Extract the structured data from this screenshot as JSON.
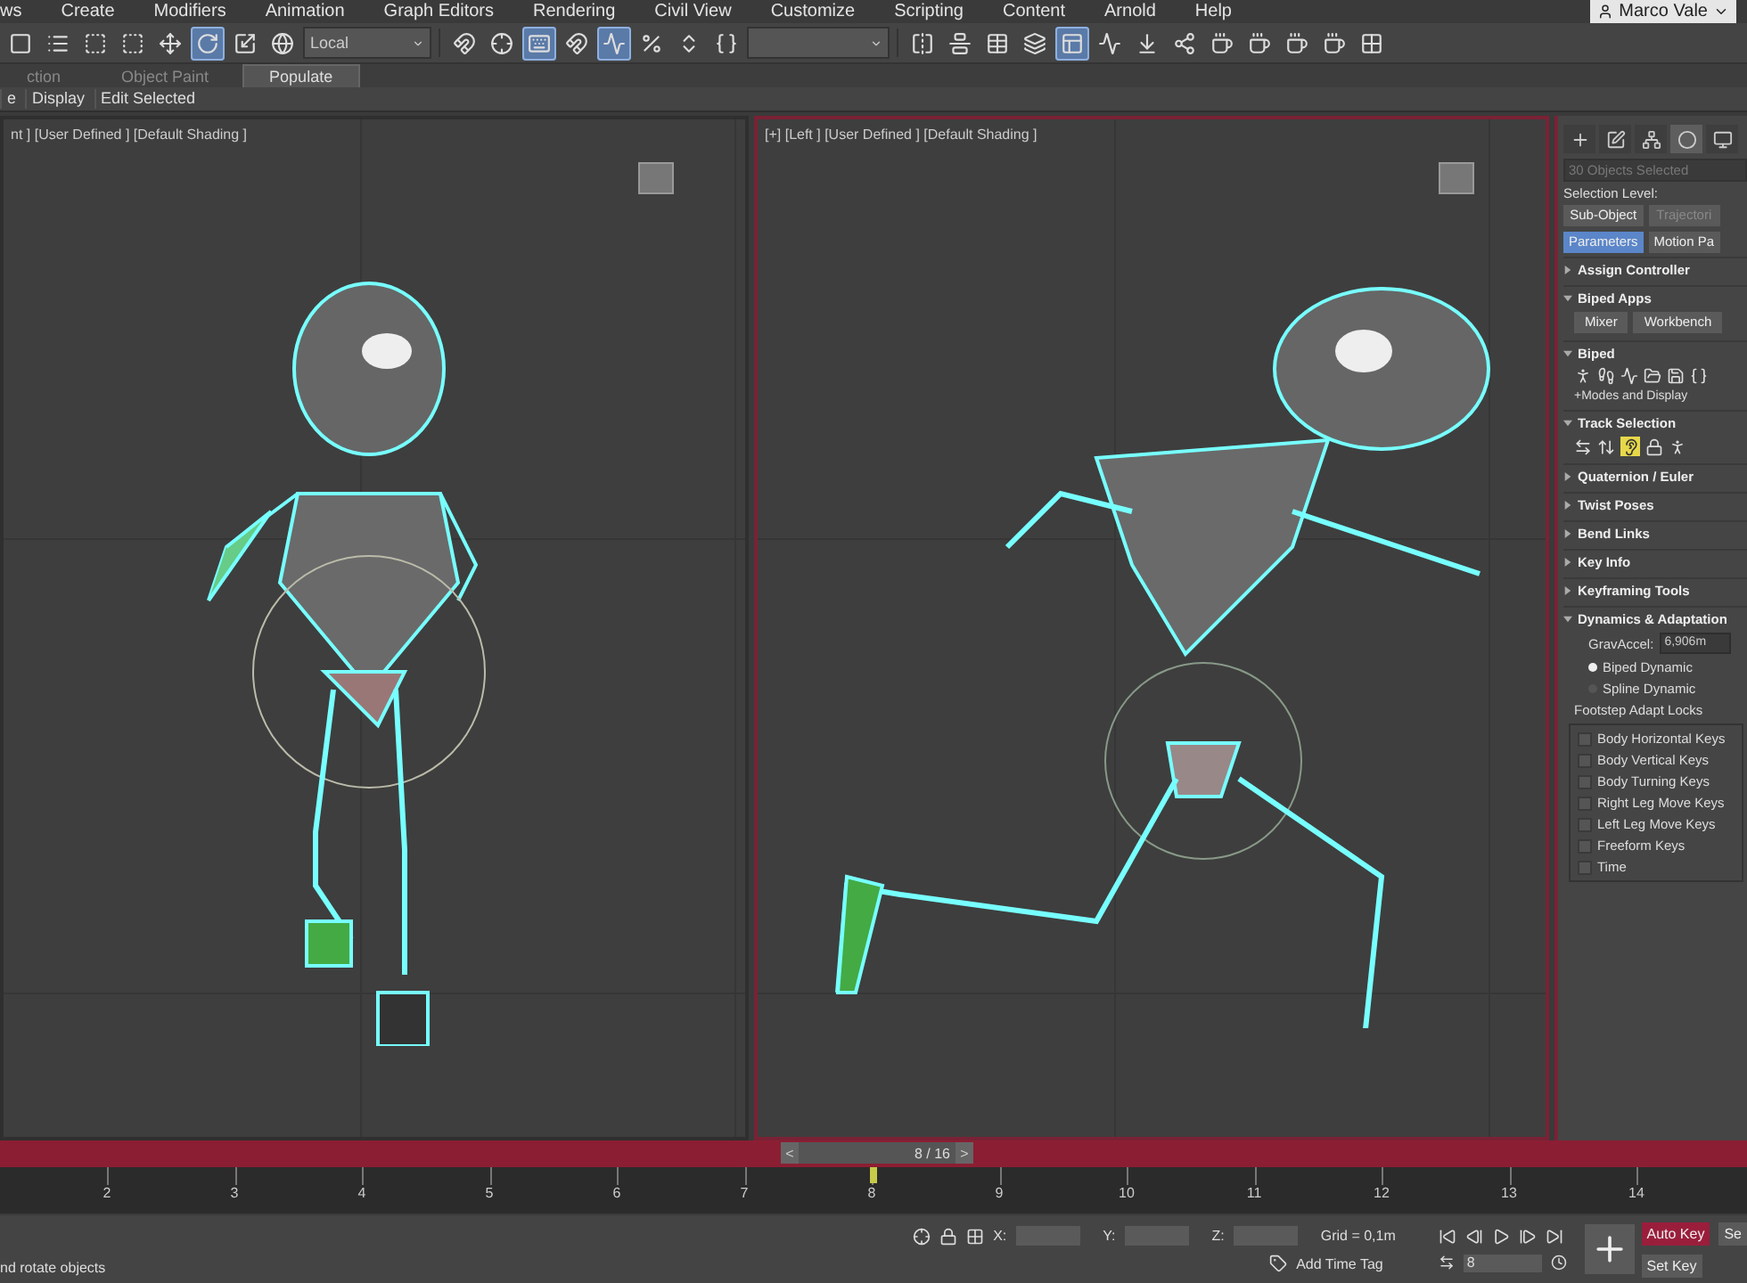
{
  "menu": [
    "ws",
    "Create",
    "Modifiers",
    "Animation",
    "Graph Editors",
    "Rendering",
    "Civil View",
    "Customize",
    "Scripting",
    "Content",
    "Arnold",
    "Help"
  ],
  "user": "Marco Vale",
  "toolbar": {
    "tools": [
      {
        "kind": "select",
        "selected": false
      },
      {
        "kind": "list",
        "selected": false
      },
      {
        "kind": "region",
        "selected": false
      },
      {
        "kind": "window",
        "selected": false
      },
      {
        "kind": "move",
        "selected": false
      },
      {
        "kind": "rotate",
        "selected": true
      },
      {
        "kind": "scale",
        "selected": false
      },
      {
        "kind": "place",
        "selected": false
      }
    ],
    "coordinate_system": "Local",
    "snaps": [
      {
        "kind": "pivot",
        "selected": false
      },
      {
        "kind": "snap",
        "selected": false
      },
      {
        "kind": "keyboard",
        "selected": true
      },
      {
        "kind": "snap3",
        "selected": false
      },
      {
        "kind": "angle",
        "selected": true
      },
      {
        "kind": "percent",
        "selected": false
      },
      {
        "kind": "spinner",
        "selected": false
      },
      {
        "kind": "braces",
        "selected": false
      }
    ],
    "right_tools": [
      {
        "kind": "mirror",
        "selected": false
      },
      {
        "kind": "align",
        "selected": false
      },
      {
        "kind": "layers",
        "selected": false
      },
      {
        "kind": "stack",
        "selected": false
      },
      {
        "kind": "ribbon",
        "selected": true
      },
      {
        "kind": "curves",
        "selected": false
      },
      {
        "kind": "dope",
        "selected": false
      },
      {
        "kind": "schematic",
        "selected": false
      },
      {
        "kind": "teapot",
        "selected": false
      },
      {
        "kind": "teapot",
        "selected": false
      },
      {
        "kind": "teapot",
        "selected": false
      },
      {
        "kind": "teapot",
        "selected": false
      },
      {
        "kind": "grid",
        "selected": false
      }
    ]
  },
  "ribbon_tabs": [
    {
      "label": "ction",
      "selected": false
    },
    {
      "label": "Object Paint",
      "selected": false
    },
    {
      "label": "Populate",
      "selected": true
    }
  ],
  "sub_tabs": [
    {
      "label": "e",
      "selected": false
    },
    {
      "label": "Display",
      "selected": false
    },
    {
      "label": "Edit Selected",
      "selected": false
    }
  ],
  "viewports": [
    {
      "label": "nt ] [User Defined ] [Default Shading ]",
      "active": false
    },
    {
      "label": "[+] [Left ] [User Defined ] [Default Shading ]",
      "active": true
    }
  ],
  "command_panel": {
    "tabs": [
      {
        "kind": "create",
        "selected": false
      },
      {
        "kind": "modify",
        "selected": false
      },
      {
        "kind": "hierarchy",
        "selected": false
      },
      {
        "kind": "motion",
        "selected": true
      },
      {
        "kind": "display",
        "selected": false
      }
    ],
    "selection_field": "30 Objects Selected",
    "selection_level": "Selection Level:",
    "level_buttons": [
      {
        "label": "Sub-Object",
        "selected": false,
        "disabled": false
      },
      {
        "label": "Trajectori",
        "selected": false,
        "disabled": true
      },
      {
        "label": "Parameters",
        "selected": true,
        "disabled": false
      },
      {
        "label": "Motion Pa",
        "selected": false,
        "disabled": false
      }
    ],
    "rollouts": [
      {
        "title": "Assign Controller",
        "expanded": false,
        "kind": "plain"
      },
      {
        "title": "Biped Apps",
        "expanded": true,
        "kind": "buttons",
        "buttons": [
          "Mixer",
          "Workbench"
        ]
      },
      {
        "title": "Biped",
        "expanded": true,
        "kind": "biped",
        "link": "+Modes and Display"
      },
      {
        "title": "Track Selection",
        "expanded": true,
        "kind": "track"
      },
      {
        "title": "Quaternion / Euler",
        "expanded": false,
        "kind": "plain"
      },
      {
        "title": "Twist Poses",
        "expanded": false,
        "kind": "plain"
      },
      {
        "title": "Bend Links",
        "expanded": false,
        "kind": "plain"
      },
      {
        "title": "Key Info",
        "expanded": false,
        "kind": "plain"
      },
      {
        "title": "Keyframing Tools",
        "expanded": false,
        "kind": "plain"
      },
      {
        "title": "Dynamics & Adaptation",
        "expanded": true,
        "kind": "dynamics",
        "grav_label": "GravAccel:",
        "grav_value": "6,906m",
        "radios": [
          {
            "label": "Biped Dynamic",
            "selected": true
          },
          {
            "label": "Spline Dynamic",
            "selected": false
          }
        ],
        "group_title": "Footstep Adapt Locks",
        "locks": [
          {
            "label": "Body Horizontal Keys",
            "checked": false
          },
          {
            "label": "Body Vertical Keys",
            "checked": false
          },
          {
            "label": "Body Turning Keys",
            "checked": false
          },
          {
            "label": "Right Leg Move Keys",
            "checked": false
          },
          {
            "label": "Left Leg Move Keys",
            "checked": false
          },
          {
            "label": "Freeform Keys",
            "checked": false
          },
          {
            "label": "Time",
            "checked": false
          }
        ]
      }
    ]
  },
  "time_slider": {
    "prev": "<",
    "frame": "8 / 16",
    "next": ">",
    "level": 0.5
  },
  "timeline": {
    "ticks": [
      "2",
      "3",
      "4",
      "5",
      "6",
      "7",
      "8",
      "9",
      "10",
      "11",
      "12",
      "13",
      "14"
    ]
  },
  "status_bar": {
    "prompt": "nd rotate objects",
    "x_label": "X:",
    "y_label": "Y:",
    "z_label": "Z:",
    "grid": "Grid = 0,1m",
    "add_time_tag": "Add Time Tag",
    "frame_field": "8",
    "auto_key": {
      "label": "Auto Key",
      "on": true
    },
    "set_key": "Set Key",
    "set_cut": "Se"
  }
}
